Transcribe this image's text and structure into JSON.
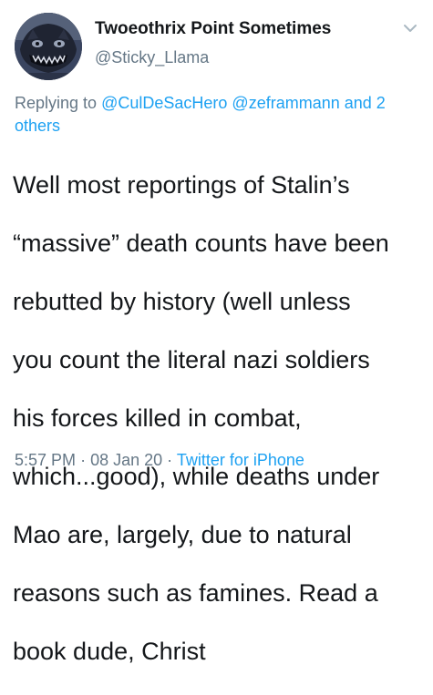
{
  "tweet": {
    "author": {
      "display_name": "Twoeothrix Point Sometimes",
      "handle": "@Sticky_Llama",
      "avatar_icon": "monster-avatar-icon"
    },
    "menu_icon": "chevron-down-icon",
    "reply": {
      "prefix": "Replying to",
      "mention_1": "@CulDeSacHero",
      "mention_2": "@zeframmann",
      "suffix_link": "and 2 others"
    },
    "text_lines": [
      "Well most reportings of Stalin’s",
      "“massive” death counts have been",
      "rebutted by history (well unless",
      "you count the literal nazi soldiers",
      "his forces killed in combat,",
      "which...good), while deaths under",
      "Mao are, largely, due to natural",
      "reasons such as famines. Read a",
      "book dude, Christ"
    ],
    "time": "5:57 PM",
    "separator": "·",
    "date": "08 Jan 20",
    "source": "Twitter for iPhone"
  },
  "colors": {
    "text": "#14171a",
    "secondary": "#657786",
    "link": "#1da1f2",
    "background": "#ffffff"
  }
}
